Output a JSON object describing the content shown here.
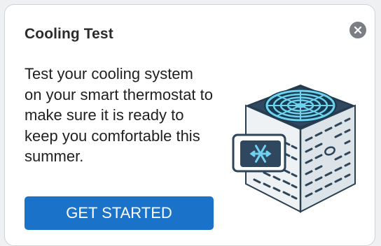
{
  "card": {
    "title": "Cooling Test",
    "body": "Test your cooling system on your smart thermostat to make sure it is ready to keep you comfortable this summer.",
    "cta_label": "GET STARTED",
    "close_icon": "close-circle-icon",
    "illustration_icon": "ac-unit-icon",
    "accent_color": "#1a72c9"
  }
}
